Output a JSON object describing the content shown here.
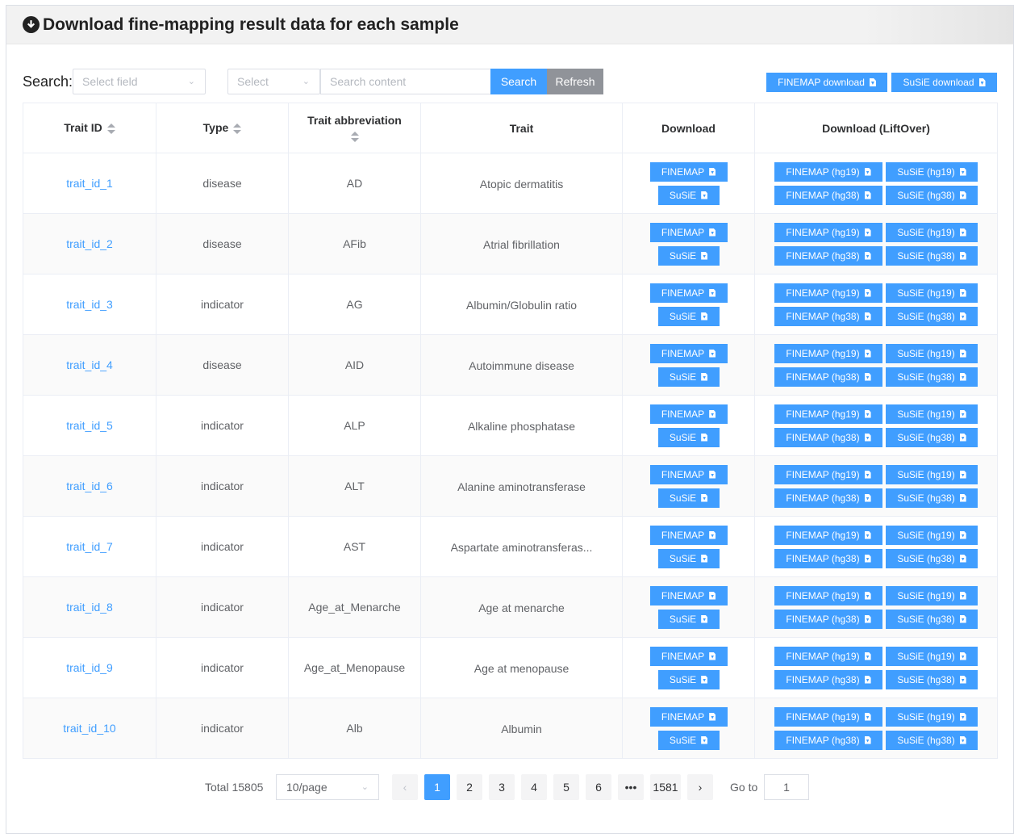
{
  "header": {
    "title": "Download fine-mapping result data for each sample",
    "icon": "download-circle-icon"
  },
  "toolbar": {
    "search_label": "Search:",
    "field_select_placeholder": "Select field",
    "select_placeholder": "Select",
    "search_content_placeholder": "Search content",
    "search_button": "Search",
    "refresh_button": "Refresh",
    "finemap_download": "FINEMAP download",
    "susie_download": "SuSiE download"
  },
  "table": {
    "columns": [
      "Trait ID",
      "Type",
      "Trait abbreviation",
      "Trait",
      "Download",
      "Download (LiftOver)"
    ],
    "button_labels": {
      "finemap": "FINEMAP",
      "susie": "SuSiE",
      "finemap_hg19": "FINEMAP (hg19)",
      "susie_hg19": "SuSiE (hg19)",
      "finemap_hg38": "FINEMAP (hg38)",
      "susie_hg38": "SuSiE (hg38)"
    },
    "rows": [
      {
        "id": "trait_id_1",
        "type": "disease",
        "abbr": "AD",
        "trait": "Atopic dermatitis"
      },
      {
        "id": "trait_id_2",
        "type": "disease",
        "abbr": "AFib",
        "trait": "Atrial fibrillation"
      },
      {
        "id": "trait_id_3",
        "type": "indicator",
        "abbr": "AG",
        "trait": "Albumin/Globulin ratio"
      },
      {
        "id": "trait_id_4",
        "type": "disease",
        "abbr": "AID",
        "trait": "Autoimmune disease"
      },
      {
        "id": "trait_id_5",
        "type": "indicator",
        "abbr": "ALP",
        "trait": "Alkaline phosphatase"
      },
      {
        "id": "trait_id_6",
        "type": "indicator",
        "abbr": "ALT",
        "trait": "Alanine aminotransferase"
      },
      {
        "id": "trait_id_7",
        "type": "indicator",
        "abbr": "AST",
        "trait": "Aspartate aminotransferas..."
      },
      {
        "id": "trait_id_8",
        "type": "indicator",
        "abbr": "Age_at_Menarche",
        "trait": "Age at menarche"
      },
      {
        "id": "trait_id_9",
        "type": "indicator",
        "abbr": "Age_at_Menopause",
        "trait": "Age at menopause"
      },
      {
        "id": "trait_id_10",
        "type": "indicator",
        "abbr": "Alb",
        "trait": "Albumin"
      }
    ]
  },
  "pagination": {
    "total": "Total 15805",
    "page_size": "10/page",
    "pages": [
      "1",
      "2",
      "3",
      "4",
      "5",
      "6",
      "•••",
      "1581"
    ],
    "current": "1",
    "goto_label": "Go to",
    "goto_value": "1"
  },
  "colors": {
    "primary": "#409eff",
    "refresh": "#909399",
    "link": "#409eff"
  }
}
